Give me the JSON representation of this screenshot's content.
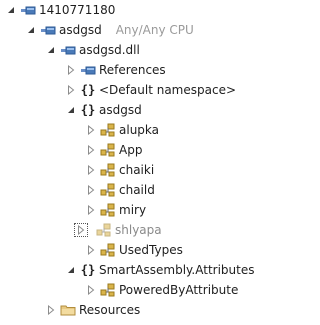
{
  "tree": {
    "root": {
      "label": "1410771180"
    },
    "project": {
      "label": "asdgsd",
      "platform": "Any/Any CPU"
    },
    "assembly": {
      "label": "asdgsd.dll"
    },
    "references": {
      "label": "References"
    },
    "default_namespace": {
      "label": "<Default namespace>"
    },
    "namespace_asdgsd": {
      "label": "asdgsd"
    },
    "classes": [
      {
        "label": "alupka"
      },
      {
        "label": "App"
      },
      {
        "label": "chaiki"
      },
      {
        "label": "chaild"
      },
      {
        "label": "miry"
      },
      {
        "label": "shlyapa"
      },
      {
        "label": "UsedTypes"
      }
    ],
    "namespace_attributes": {
      "label": "SmartAssembly.Attributes"
    },
    "powered_by": {
      "label": "PoweredByAttribute"
    },
    "resources": {
      "label": "Resources"
    }
  },
  "colors": {
    "arrow_expanded": "#3c3c3c",
    "arrow_collapsed": "#8c8c8c",
    "class_icon": "#b8860b",
    "class_icon_highlight": "#e6c84a",
    "folder": "#dcb67a",
    "assembly_icon": "#4a7ab8"
  }
}
